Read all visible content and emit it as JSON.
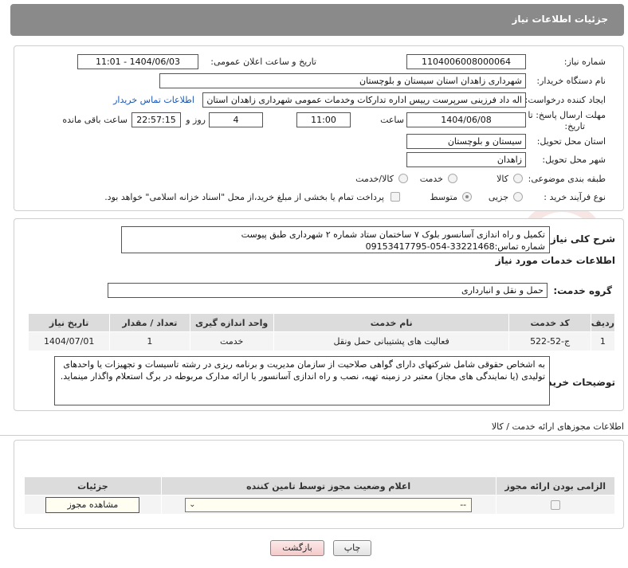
{
  "header": {
    "title": "جزئیات اطلاعات نیاز"
  },
  "info": {
    "need_number_label": "شماره نیاز:",
    "need_number": "1104006008000064",
    "announce_label": "تاریخ و ساعت اعلان عمومی:",
    "announce_value": "1404/06/03 - 11:01",
    "buyer_label": "نام دستگاه خریدار:",
    "buyer_value": "شهرداری زاهدان استان سیستان و بلوچستان",
    "creator_label": "ایجاد کننده درخواست:",
    "creator_value": "اله داد فرزینی سرپرست رییس اداره تدارکات وخدمات عمومی شهرداری زاهدان استان",
    "contact_link": "اطلاعات تماس خریدار",
    "deadline_label_1": "مهلت ارسال پاسخ: تا",
    "deadline_label_2": "تاریخ:",
    "deadline_date": "1404/06/08",
    "time_label": "ساعت",
    "deadline_time": "11:00",
    "days_value": "4",
    "days_label": "روز و",
    "remaining_time": "22:57:15",
    "remaining_label": "ساعت باقی مانده",
    "province_label": "استان محل تحویل:",
    "province_value": "سیستان و بلوچستان",
    "city_label": "شهر محل تحویل:",
    "city_value": "زاهدان",
    "category_label": "طبقه بندی موضوعی:",
    "category_options": [
      "کالا",
      "خدمت",
      "کالا/خدمت"
    ],
    "process_label": "نوع فرآیند خرید :",
    "process_options": [
      "جزیی",
      "متوسط"
    ],
    "payment_note": "پرداخت تمام یا بخشی از مبلغ خرید،از محل \"اسناد خزانه اسلامی\" خواهد بود."
  },
  "summary": {
    "label": "شرح کلی نیاز:",
    "line1": "تکمیل و راه اندازی آسانسور بلوک ۷ ساختمان ستاد شماره ۲ شهرداری طبق پیوست",
    "line2": "شماره تماس:33221468-054-09153417795"
  },
  "services": {
    "title": "اطلاعات خدمات مورد نیاز",
    "group_label": "گروه خدمت:",
    "group_value": "حمل و نقل و انبارداری",
    "headers": [
      "ردیف",
      "کد خدمت",
      "نام خدمت",
      "واحد اندازه گیری",
      "تعداد / مقدار",
      "تاریخ نیاز"
    ],
    "rows": [
      [
        "1",
        "ج-52-522",
        "فعالیت های پشتیبانی حمل ونقل",
        "خدمت",
        "1",
        "1404/07/01"
      ]
    ]
  },
  "buyer_notes": {
    "label": "توضیحات خریدار:",
    "text": "به اشخاص حقوقی شامل شرکتهای دارای گواهی صلاحیت از سازمان مدیریت و برنامه ریزی در رشته تاسیسات و تجهیزات یا واحدهای تولیدی (یا نمایندگی های مجاز) معتبر در زمینه تهیه، نصب و راه اندازی آسانسور با ارائه مدارک مربوطه در برگ استعلام واگذار مینماید."
  },
  "permits": {
    "title": "اطلاعات مجوزهای ارائه خدمت / کالا",
    "headers": [
      "الزامی بودن ارائه مجوز",
      "اعلام وضعیت مجوز توسط تامین کننده",
      "جزئیات"
    ],
    "select_value": "--",
    "view_button": "مشاهده مجوز"
  },
  "actions": {
    "print": "چاپ",
    "back": "بازگشت"
  },
  "colors": {
    "header_bg": "#8a8a8a",
    "table_head": "#dcdcdc",
    "link": "#1a57b5"
  }
}
